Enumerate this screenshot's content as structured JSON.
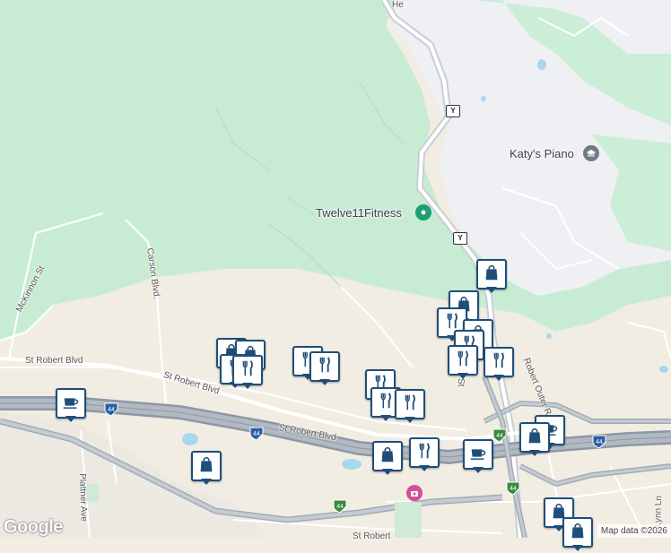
{
  "map": {
    "pois": {
      "katys_piano": "Katy's Piano",
      "twelve11": "Twelve11Fitness"
    },
    "streets": {
      "mckinnon": "McKinnon St",
      "carson": "Carson Blvd.",
      "st_robert_blvd_left": "St Robert Blvd",
      "st_robert_blvd_mid": "St Robert Blvd",
      "st_robert_blvd_right": "St Robert Blvd",
      "outer_rd": "Robert Outer Rd",
      "plattner": "Plattner Ave",
      "lynn": "Lynn Ln",
      "st_short": "St",
      "he_top": "He",
      "st_robert_bottom": "St Robert"
    },
    "shields": {
      "y1": "Y",
      "y2": "Y",
      "i44": "44"
    },
    "colors": {
      "forest": "#c8ecd3",
      "urban": "#f2ede2",
      "residential": "#eef0f3",
      "highway": "#9aa3ae",
      "marker_border": "#1f4e79",
      "water": "#a8d8ee",
      "pin_green": "#1e9e6e",
      "pin_grey": "#6f7b85",
      "pin_pink": "#d44f9a"
    },
    "marker_icons": [
      "shopping-bag-icon",
      "utensils-icon",
      "coffee-cup-icon"
    ]
  },
  "footer": {
    "logo": "Google",
    "attribution": "Map data ©2026"
  }
}
